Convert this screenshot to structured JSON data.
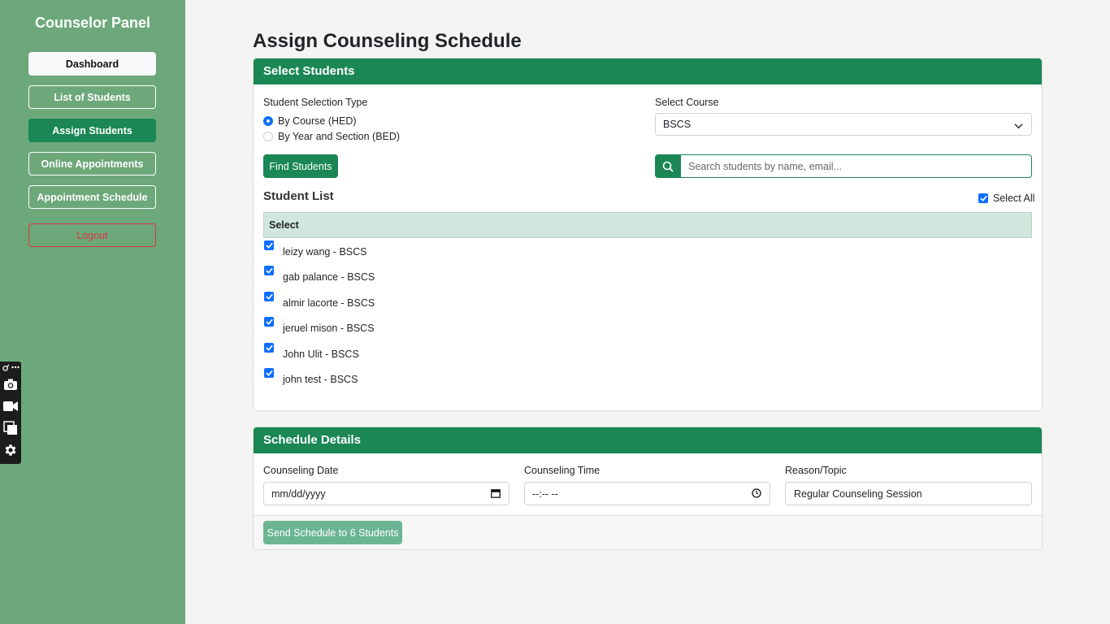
{
  "sidebar": {
    "title": "Counselor Panel",
    "items": [
      {
        "label": "Dashboard"
      },
      {
        "label": "List of Students"
      },
      {
        "label": "Assign Students"
      },
      {
        "label": "Online Appointments"
      },
      {
        "label": "Appointment Schedule"
      }
    ],
    "logout": "Logout"
  },
  "page": {
    "title": "Assign Counseling Schedule"
  },
  "select_students": {
    "header": "Select Students",
    "selection_type_label": "Student Selection Type",
    "option_hed": "By Course (HED)",
    "option_bed": "By Year and Section (BED)",
    "course_label": "Select Course",
    "course_value": "BSCS",
    "find_button": "Find Students",
    "search_placeholder": "Search students by name, email...",
    "student_list_title": "Student List",
    "select_all_label": "Select All",
    "table_header": "Select",
    "students": [
      "leizy wang - BSCS",
      "gab palance - BSCS",
      "almir lacorte - BSCS",
      "jeruel mison - BSCS",
      "John Ulit - BSCS",
      "john test - BSCS"
    ]
  },
  "schedule": {
    "header": "Schedule Details",
    "date_label": "Counseling Date",
    "date_value": "mm/dd/yyyy",
    "time_label": "Counseling Time",
    "time_value": "--:-- --",
    "reason_label": "Reason/Topic",
    "reason_value": "Regular Counseling Session",
    "send_button": "Send Schedule to 6 Students"
  },
  "toolbar_icons": [
    "pin-icon",
    "more-icon",
    "camera-icon",
    "video-icon",
    "copy-icon",
    "gear-icon"
  ],
  "colors": {
    "primary_green": "#1a8754",
    "sidebar_green": "#6da87a",
    "danger": "#dc3545",
    "checkbox_blue": "#0d6efd"
  }
}
